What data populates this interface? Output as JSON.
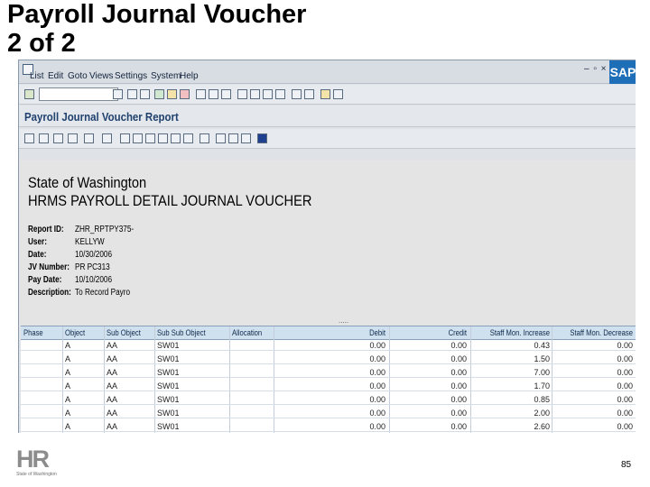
{
  "slide": {
    "title_line1": "Payroll Journal Voucher",
    "title_line2": "2 of 2",
    "page_number": "85"
  },
  "logo": {
    "letters": "HR",
    "subtitle": "State of Washington"
  },
  "sap": {
    "menu": [
      "List",
      "Edit",
      "Goto",
      "Views",
      "Settings",
      "System",
      "Help"
    ],
    "window_controls": "– ▫ ×",
    "brand": "SAP",
    "app_title": "Payroll Journal Voucher Report"
  },
  "report": {
    "line1": "State of Washington",
    "line2": "HRMS PAYROLL DETAIL JOURNAL VOUCHER",
    "fields": [
      {
        "label": "Report ID:",
        "value": "ZHR_RPTPY375-"
      },
      {
        "label": "User:",
        "value": "KELLYW"
      },
      {
        "label": "Date:",
        "value": "10/30/2006"
      },
      {
        "label": "JV Number:",
        "value": "PR PC313"
      },
      {
        "label": "Pay Date:",
        "value": "10/10/2006"
      },
      {
        "label": "Description:",
        "value": "To Record Payro"
      }
    ]
  },
  "grid": {
    "columns": [
      "Phase",
      "Object",
      "Sub Object",
      "Sub Sub Object",
      "Allocation",
      "Debit",
      "Credit",
      "Staff Mon. Increase",
      "Staff Mon. Decrease"
    ],
    "rows": [
      [
        "",
        "A",
        "AA",
        "SW01",
        "",
        "0.00",
        "0.00",
        "0.43",
        "0.00"
      ],
      [
        "",
        "A",
        "AA",
        "SW01",
        "",
        "0.00",
        "0.00",
        "1.50",
        "0.00"
      ],
      [
        "",
        "A",
        "AA",
        "SW01",
        "",
        "0.00",
        "0.00",
        "7.00",
        "0.00"
      ],
      [
        "",
        "A",
        "AA",
        "SW01",
        "",
        "0.00",
        "0.00",
        "1.70",
        "0.00"
      ],
      [
        "",
        "A",
        "AA",
        "SW01",
        "",
        "0.00",
        "0.00",
        "0.85",
        "0.00"
      ],
      [
        "",
        "A",
        "AA",
        "SW01",
        "",
        "0.00",
        "0.00",
        "2.00",
        "0.00"
      ],
      [
        "",
        "A",
        "AA",
        "SW01",
        "",
        "0.00",
        "0.00",
        "2.60",
        "0.00"
      ]
    ]
  }
}
